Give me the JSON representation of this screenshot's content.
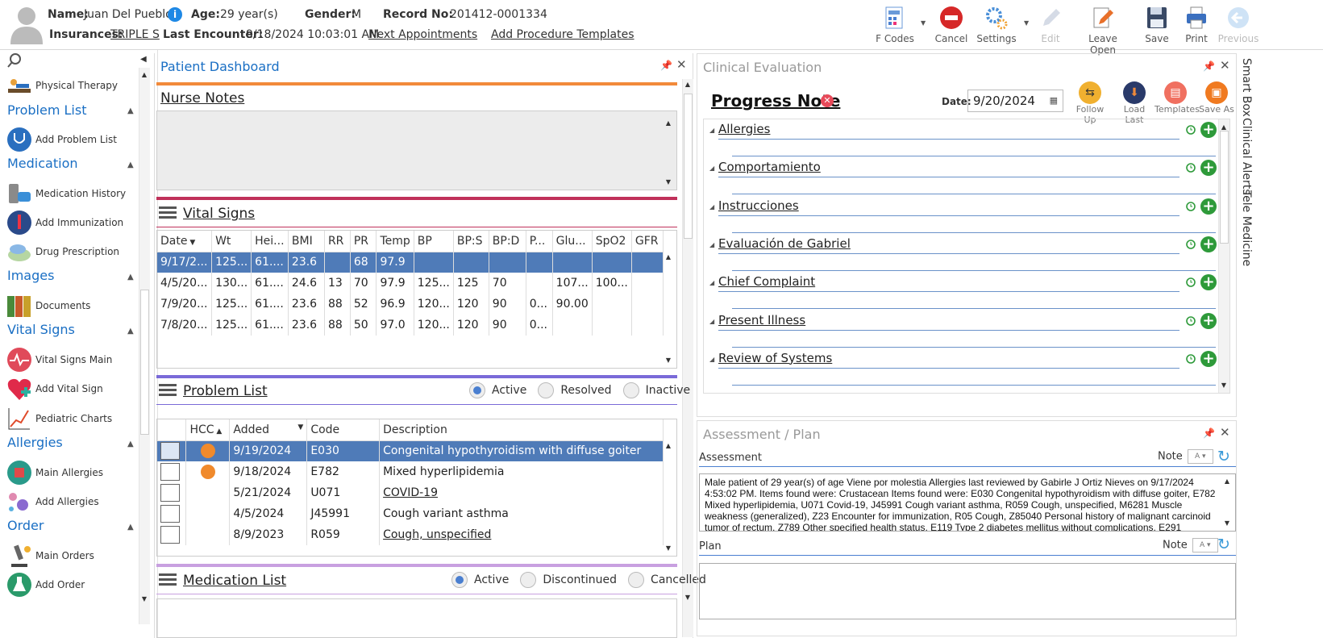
{
  "patient": {
    "name_label": "Name:",
    "name": "Juan Del Pueblo",
    "age_label": "Age:",
    "age": "29 year(s)",
    "gender_label": "Gender:",
    "gender": "M",
    "record_label": "Record No:",
    "record": "201412-0001334",
    "ins_label": "Insurances:",
    "insurance": "TRIPLE S",
    "last_label": "Last Encounter:",
    "last_encounter": "9/18/2024 10:03:01 AM",
    "next_appointments": "Next Appointments",
    "add_procedure": "Add Procedure Templates"
  },
  "toolbar": {
    "fcodes": "F Codes",
    "cancel": "Cancel",
    "settings": "Settings",
    "edit": "Edit",
    "leave_open": "Leave Open",
    "save": "Save",
    "print": "Print",
    "previous": "Previous"
  },
  "sidebar": {
    "physical_therapy": "Physical Therapy",
    "problem_list": "Problem List",
    "add_problem_list": "Add Problem List",
    "medication": "Medication",
    "medication_history": "Medication History",
    "add_immunization": "Add Immunization",
    "drug_prescription": "Drug Prescription",
    "images": "Images",
    "documents": "Documents",
    "vital_signs": "Vital Signs",
    "vital_signs_main": "Vital Signs Main",
    "add_vital_sign": "Add Vital Sign",
    "pediatric_charts": "Pediatric Charts",
    "allergies": "Allergies",
    "main_allergies": "Main Allergies",
    "add_allergies": "Add Allergies",
    "order": "Order",
    "main_orders": "Main Orders",
    "add_order": "Add Order"
  },
  "dashboard": {
    "title": "Patient Dashboard",
    "nurse_notes": "Nurse Notes",
    "vital_signs": "Vital Signs",
    "vitals_headers": [
      "Date",
      "Wt",
      "Hei...",
      "BMI",
      "RR",
      "PR",
      "Temp",
      "BP",
      "BP:S",
      "BP:D",
      "P...",
      "Glu...",
      "SpO2",
      "GFR"
    ],
    "vitals_rows": [
      [
        "9/17/2...",
        "125...",
        "61....",
        "23.6",
        "",
        "68",
        "97.9",
        "",
        "",
        "",
        "",
        "",
        "",
        ""
      ],
      [
        "4/5/20...",
        "130...",
        "61....",
        "24.6",
        "13",
        "70",
        "97.9",
        "125...",
        "125",
        "70",
        "",
        "107...",
        "100...",
        ""
      ],
      [
        "7/9/20...",
        "125...",
        "61....",
        "23.6",
        "88",
        "52",
        "96.9",
        "120...",
        "120",
        "90",
        "0...",
        "90.00",
        "",
        ""
      ],
      [
        "7/8/20...",
        "125...",
        "61....",
        "23.6",
        "88",
        "50",
        "97.0",
        "120...",
        "120",
        "90",
        "0...",
        "",
        "",
        ""
      ]
    ],
    "problem_list": "Problem List",
    "pl_active": "Active",
    "pl_resolved": "Resolved",
    "pl_inactive": "Inactive",
    "problem_headers": [
      "",
      "HCC",
      "Added",
      "Code",
      "Description"
    ],
    "problems": [
      {
        "hcc": true,
        "added": "9/19/2024",
        "code": "E030",
        "desc": "Congenital hypothyroidism with diffuse goiter"
      },
      {
        "hcc": true,
        "added": "9/18/2024",
        "code": "E782",
        "desc": "Mixed hyperlipidemia"
      },
      {
        "hcc": false,
        "added": "5/21/2024",
        "code": "U071",
        "desc": "COVID-19"
      },
      {
        "hcc": false,
        "added": "4/5/2024",
        "code": "J45991",
        "desc": "Cough variant asthma"
      },
      {
        "hcc": false,
        "added": "8/9/2023",
        "code": "R059",
        "desc": "Cough, unspecified"
      }
    ],
    "medication_list": "Medication List",
    "ml_active": "Active",
    "ml_discontinued": "Discontinued",
    "ml_cancelled": "Cancelled"
  },
  "clinical": {
    "title": "Clinical Evaluation",
    "note_title": "Progress Note",
    "date_label": "Date:",
    "date": "9/20/2024",
    "actions": [
      "Follow Up",
      "Load Last",
      "Templates",
      "Save As"
    ],
    "categories": [
      "Allergies",
      "Comportamiento",
      "Instrucciones",
      "Evaluación de Gabriel",
      "Chief Complaint",
      "Present Illness",
      "Review of Systems"
    ]
  },
  "assessment": {
    "title": "Assessment / Plan",
    "assessment_label": "Assessment",
    "note_label": "Note",
    "plan_label": "Plan",
    "text": "Male patient of 29 year(s) of age Viene por molestia     Allergies last reviewed by Gabirle J Ortiz Nieves on 9/17/2024 4:53:02 PM.   Items found were:  Crustacean  Items found were:  E030 Congenital hypothyroidism with diffuse goiter, E782 Mixed hyperlipidemia, U071 Covid-19, J45991 Cough variant asthma, R059 Cough, unspecified, M6281 Muscle weakness (generalized), Z23 Encounter for immunization, R05 Cough, Z85040 Personal history of malignant carcinoid tumor of rectum, Z789 Other specified health status, E119 Type 2 diabetes mellitus without complications, E291"
  },
  "side_tabs": [
    "Smart Box",
    "Clinical Alerts",
    "Tele Medicine"
  ]
}
